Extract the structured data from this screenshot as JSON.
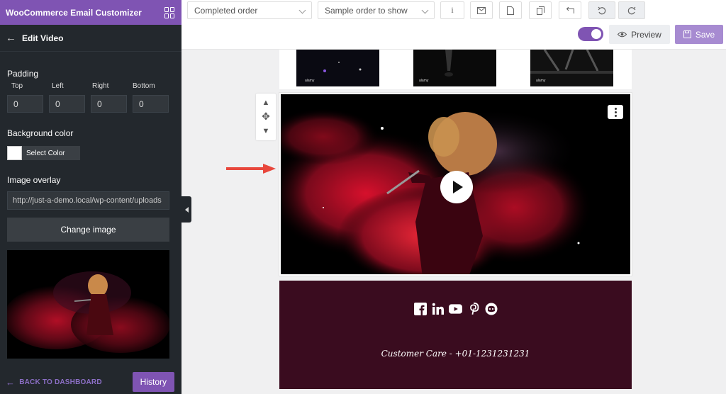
{
  "sidebar": {
    "app_title": "WooCommerce Email Customizer",
    "section_title": "Edit Video",
    "padding": {
      "label": "Padding",
      "fields": [
        {
          "label": "Top",
          "value": "0"
        },
        {
          "label": "Left",
          "value": "0"
        },
        {
          "label": "Right",
          "value": "0"
        },
        {
          "label": "Bottom",
          "value": "0"
        }
      ]
    },
    "background_color": {
      "label": "Background color",
      "button": "Select Color",
      "value": "#ffffff"
    },
    "image_overlay": {
      "label": "Image overlay",
      "url": "http://just-a-demo.local/wp-content/uploads",
      "change_button": "Change image"
    },
    "back_link": "BACK TO DASHBOARD",
    "history_button": "History"
  },
  "toolbar": {
    "email_type": "Completed order",
    "sample_order": "Sample order to show",
    "tools": [
      "info-icon",
      "mail-icon",
      "document-icon",
      "copy-icon",
      "reply-icon",
      "undo-icon",
      "redo-icon"
    ],
    "info_label": "i",
    "preview_label": "Preview",
    "save_label": "Save"
  },
  "email": {
    "thumb_watermark": "alamy",
    "footer": {
      "background": "#3a0c1f",
      "social_icons": [
        "facebook-icon",
        "linkedin-icon",
        "youtube-icon",
        "pinterest-icon",
        "discord-icon"
      ],
      "contact": "Customer Care - +01-1231231231"
    }
  },
  "colors": {
    "accent": "#7f54b3",
    "sidebar_bg": "#23282d",
    "save_bg": "#a78bd1",
    "arrow": "#e8473c"
  }
}
